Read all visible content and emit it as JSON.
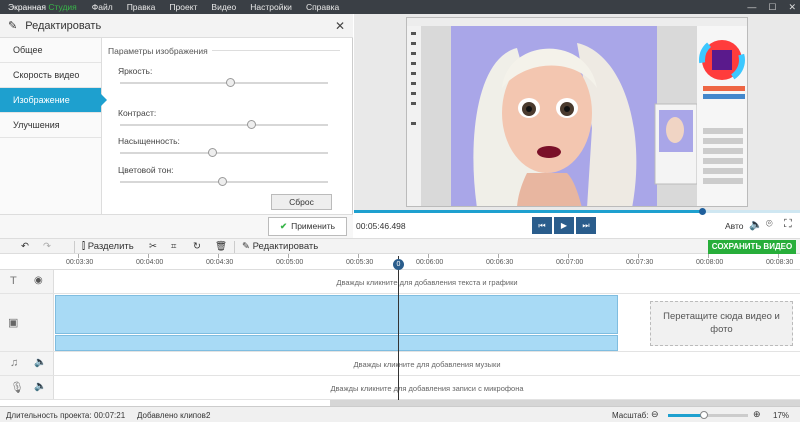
{
  "menubar": {
    "app_name_prefix": "Экранная ",
    "app_name_brand": "Студия",
    "items": [
      "Файл",
      "Правка",
      "Проект",
      "Видео",
      "Настройки",
      "Справка"
    ],
    "window_controls": [
      "—",
      "☐",
      "✕"
    ]
  },
  "edit_panel": {
    "title": "Редактировать",
    "nav": [
      "Общее",
      "Скорость видео",
      "Изображение",
      "Улучшения"
    ],
    "active_nav": 2,
    "params_title": "Параметры изображения",
    "sliders": [
      {
        "label": "Яркость:",
        "value": 0.53
      },
      {
        "label": "Контраст:",
        "value": 0.63
      },
      {
        "label": "Насыщенность:",
        "value": 0.44
      },
      {
        "label": "Цветовой тон:",
        "value": 0.49
      }
    ],
    "reset_label": "Сброс",
    "apply_label": "Применить"
  },
  "player": {
    "current_time": "00:05:46.498",
    "progress": 0.78,
    "auto_label": "Авто"
  },
  "toolbar": {
    "split_label": "Разделить",
    "edit_label": "Редактировать",
    "save_label": "СОХРАНИТЬ ВИДЕО"
  },
  "ruler": {
    "ticks": [
      "00:03:30",
      "00:04:00",
      "00:04:30",
      "00:05:00",
      "00:05:30",
      "00:06:00",
      "00:06:30",
      "00:07:00",
      "00:07:30",
      "00:08:00",
      "00:08:30"
    ]
  },
  "timeline": {
    "text_hint": "Дважды кликните для добавления текста и графики",
    "music_hint": "Дважды кликните для добавления музыки",
    "mic_hint": "Дважды кликните для добавления записи с микрофона",
    "dropzone_label": "Перетащите сюда видео и фото",
    "playhead_label": "0"
  },
  "status": {
    "duration_label": "Длительность проекта:",
    "duration_value": "00:07:21",
    "clips_label": "Добавлено клипов:",
    "clips_value": "2",
    "zoom_label": "Масштаб:",
    "zoom_value": "17%",
    "zoom_level": 0.45
  },
  "colors": {
    "accent": "#1ea0cf",
    "save_green": "#27ae3a",
    "menubar": "#3a3f45"
  }
}
